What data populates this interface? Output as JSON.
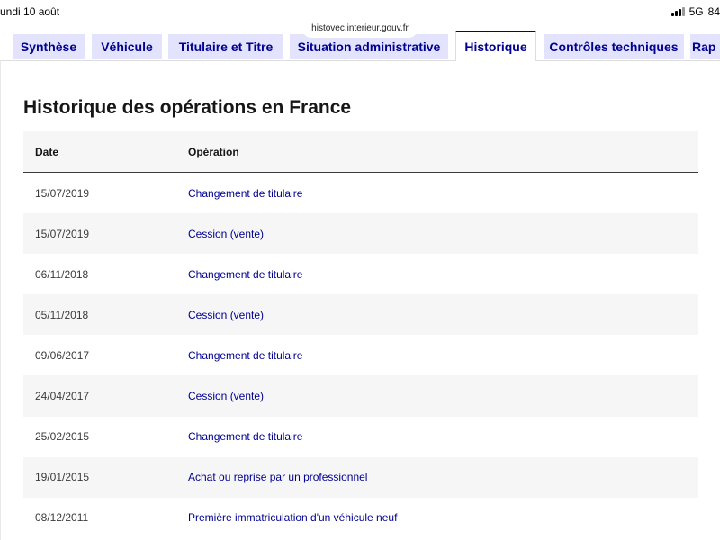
{
  "status_bar": {
    "time": "undi 10 août",
    "network": "5G",
    "battery": "84"
  },
  "browser": {
    "url": "histovec.interieur.gouv.fr"
  },
  "tabs": [
    {
      "label": "Synthèse",
      "active": false
    },
    {
      "label": "Véhicule",
      "active": false
    },
    {
      "label": "Titulaire et Titre",
      "active": false
    },
    {
      "label": "Situation administrative",
      "active": false
    },
    {
      "label": "Historique",
      "active": true
    },
    {
      "label": "Contrôles techniques",
      "active": false
    },
    {
      "label": "Rap",
      "active": false
    }
  ],
  "section": {
    "title": "Historique des opérations en France"
  },
  "table": {
    "headers": {
      "date": "Date",
      "operation": "Opération"
    },
    "rows": [
      {
        "date": "15/07/2019",
        "operation": "Changement de titulaire"
      },
      {
        "date": "15/07/2019",
        "operation": "Cession (vente)"
      },
      {
        "date": "06/11/2018",
        "operation": "Changement de titulaire"
      },
      {
        "date": "05/11/2018",
        "operation": "Cession (vente)"
      },
      {
        "date": "09/06/2017",
        "operation": "Changement de titulaire"
      },
      {
        "date": "24/04/2017",
        "operation": "Cession (vente)"
      },
      {
        "date": "25/02/2015",
        "operation": "Changement de titulaire"
      },
      {
        "date": "19/01/2015",
        "operation": "Achat ou reprise par un professionnel"
      },
      {
        "date": "08/12/2011",
        "operation": "Première immatriculation d'un véhicule neuf"
      }
    ]
  },
  "colors": {
    "accent": "#000091",
    "tab_background": "#e3e3fd",
    "row_stripe": "#f6f6f6"
  }
}
